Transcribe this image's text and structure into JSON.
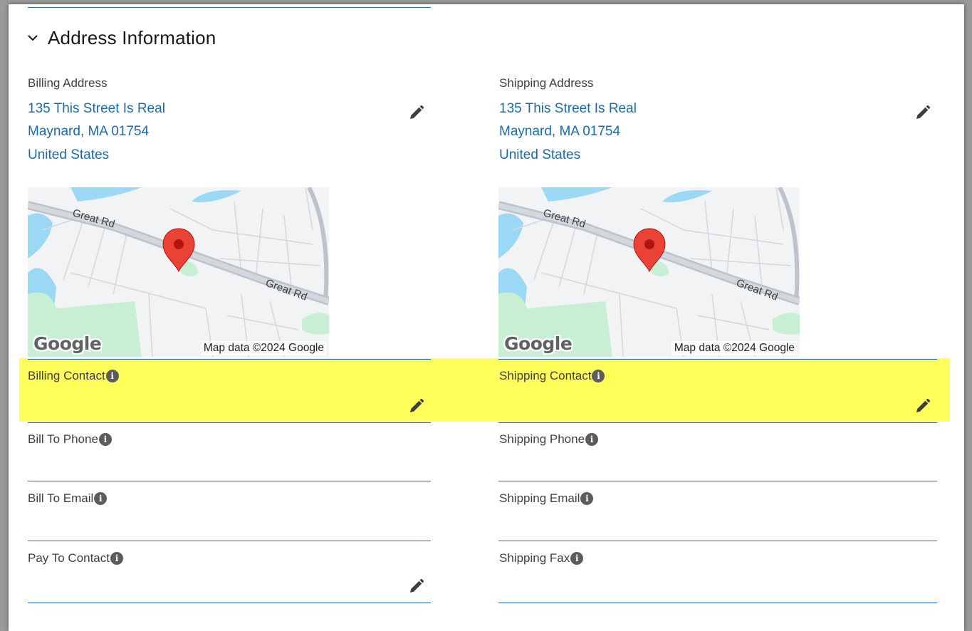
{
  "section": {
    "title": "Address Information"
  },
  "billing": {
    "address_label": "Billing Address",
    "address_lines": [
      "135 This Street Is Real",
      "Maynard, MA 01754",
      "United States"
    ],
    "map": {
      "logo": "Google",
      "attribution": "Map data ©2024 Google",
      "road_1": "Great Rd",
      "road_2": "Great Rd"
    },
    "fields": [
      {
        "label": "Billing Contact",
        "editable": true
      },
      {
        "label": "Bill To Phone",
        "editable": false
      },
      {
        "label": "Bill To Email",
        "editable": false
      },
      {
        "label": "Pay To Contact",
        "editable": true
      }
    ]
  },
  "shipping": {
    "address_label": "Shipping Address",
    "address_lines": [
      "135 This Street Is Real",
      "Maynard, MA 01754",
      "United States"
    ],
    "map": {
      "logo": "Google",
      "attribution": "Map data ©2024 Google",
      "road_1": "Great Rd",
      "road_2": "Great Rd"
    },
    "fields": [
      {
        "label": "Shipping Contact",
        "editable": true
      },
      {
        "label": "Shipping Phone",
        "editable": false
      },
      {
        "label": "Shipping Email",
        "editable": false
      },
      {
        "label": "Shipping Fax",
        "editable": false
      }
    ]
  },
  "icons": {
    "toggle": "chevron-down-icon",
    "info": "info-icon",
    "edit": "pencil-icon",
    "marker": "map-pin-icon"
  },
  "colors": {
    "link": "#1c6aa8",
    "highlight": "#ffff5c",
    "divider": "#2a6ea8",
    "pin": "#ea4335"
  }
}
